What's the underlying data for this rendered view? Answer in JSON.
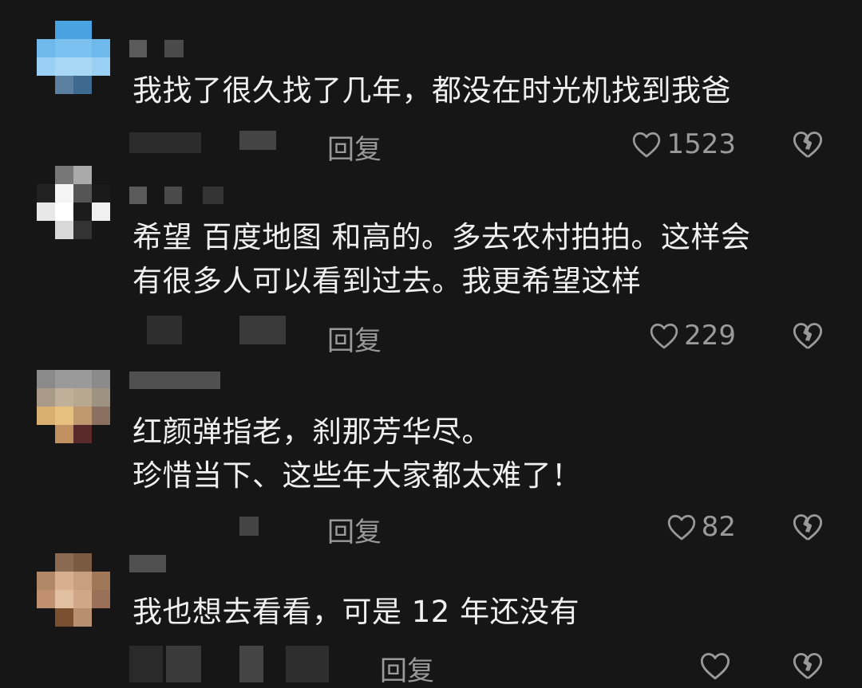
{
  "comments": [
    {
      "text": "我找了很久找了几年，都没在时光机找到我爸",
      "reply_label": "回复",
      "likes": "1523",
      "avatar_colors": [
        "#161616",
        "#4aa3e0",
        "#4aa3e0",
        "#161616",
        "#6fb8ec",
        "#7cc2f0",
        "#7cc2f0",
        "#6fb8ec",
        "#9ad0f4",
        "#a8d8f6",
        "#a8d8f6",
        "#9ad0f4",
        "#161616",
        "#5b7fa0",
        "#3f6a90",
        "#161616"
      ]
    },
    {
      "text": "希望 百度地图 和高的。多去农村拍拍。这样会\n有很多人可以看到过去。我更希望这样",
      "reply_label": "回复",
      "likes": "229",
      "avatar_colors": [
        "#161616",
        "#777777",
        "#aaaaaa",
        "#161616",
        "#222222",
        "#f5f5f5",
        "#555555",
        "#1a1a1a",
        "#e8e8e8",
        "#ffffff",
        "#1c1c1c",
        "#f0f0f0",
        "#161616",
        "#d8d8d8",
        "#333333",
        "#161616"
      ]
    },
    {
      "text": "红颜弹指老，刹那芳华尽。\n珍惜当下、这些年大家都太难了！",
      "reply_label": "回复",
      "likes": "82",
      "avatar_colors": [
        "#8a8a8a",
        "#9a9a9a",
        "#9a9a9a",
        "#8a8a8a",
        "#a89a86",
        "#c0b09a",
        "#b8a890",
        "#9e9282",
        "#d9b070",
        "#e8c080",
        "#c09870",
        "#8a7060",
        "#161616",
        "#c09060",
        "#5a2a2a",
        "#161616"
      ]
    },
    {
      "text": "我也想去看看，可是 12 年还没有",
      "reply_label": "回复",
      "likes": "",
      "avatar_colors": [
        "#161616",
        "#8a6a50",
        "#7a5a40",
        "#161616",
        "#b08868",
        "#d8b090",
        "#c8a080",
        "#a07858",
        "#c09070",
        "#e0c0a0",
        "#d0a888",
        "#9a7058",
        "#161616",
        "#7a5030",
        "#b89070",
        "#161616"
      ]
    }
  ]
}
